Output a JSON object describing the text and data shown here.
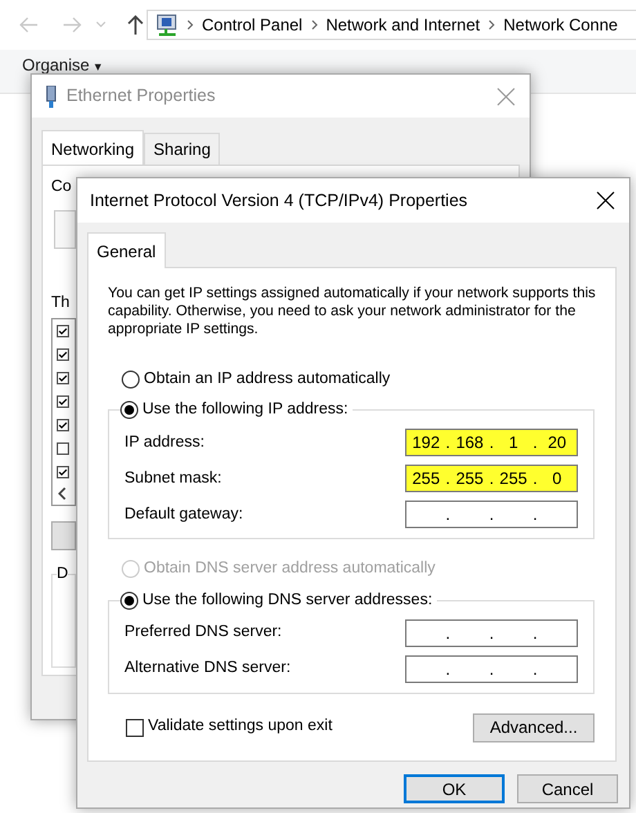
{
  "explorer": {
    "breadcrumbs": [
      "Control Panel",
      "Network and Internet",
      "Network Conne"
    ],
    "toolbar": {
      "organise": "Organise",
      "organise_caret": "▼"
    }
  },
  "ethernet_window": {
    "title": "Ethernet Properties",
    "active": false,
    "tabs": [
      {
        "label": "Networking",
        "selected": true
      },
      {
        "label": "Sharing",
        "selected": false
      }
    ],
    "connect_label": "Co",
    "components_label": "Th",
    "components": [
      {
        "checked": true
      },
      {
        "checked": true
      },
      {
        "checked": true
      },
      {
        "checked": true
      },
      {
        "checked": true
      },
      {
        "checked": false
      },
      {
        "checked": true
      }
    ],
    "group_label": "D"
  },
  "ipv4_window": {
    "title": "Internet Protocol Version 4 (TCP/IPv4) Properties",
    "active": true,
    "tabs": [
      {
        "label": "General",
        "selected": true
      }
    ],
    "intro": "You can get IP settings assigned automatically if your network supports this capability. Otherwise, you need to ask your network administrator for the appropriate IP settings.",
    "ip_options": [
      {
        "label": "Obtain an IP address automatically",
        "selected": false,
        "disabled": false
      },
      {
        "label": "Use the following IP address:",
        "selected": true,
        "disabled": false
      }
    ],
    "ip_fields": [
      {
        "label": "IP address:",
        "separator": ".",
        "octets": [
          "192",
          "168",
          "1",
          "20"
        ],
        "highlighted": true
      },
      {
        "label": "Subnet mask:",
        "separator": ".",
        "octets": [
          "255",
          "255",
          "255",
          "0"
        ],
        "highlighted": true
      },
      {
        "label": "Default gateway:",
        "separator": ".",
        "highlighted": false
      }
    ],
    "dns_options": [
      {
        "label": "Obtain DNS server address automatically",
        "selected": false,
        "disabled": true
      },
      {
        "label": "Use the following DNS server addresses:",
        "selected": true,
        "disabled": false
      }
    ],
    "dns_fields": [
      {
        "label": "Preferred DNS server:",
        "separator": ".",
        "highlighted": false
      },
      {
        "label": "Alternative DNS server:",
        "separator": ".",
        "highlighted": false
      }
    ],
    "validate": {
      "label": "Validate settings upon exit",
      "checked": false
    },
    "advanced_button": "Advanced...",
    "buttons": [
      {
        "label": "OK",
        "default": true
      },
      {
        "label": "Cancel",
        "default": false
      }
    ]
  }
}
